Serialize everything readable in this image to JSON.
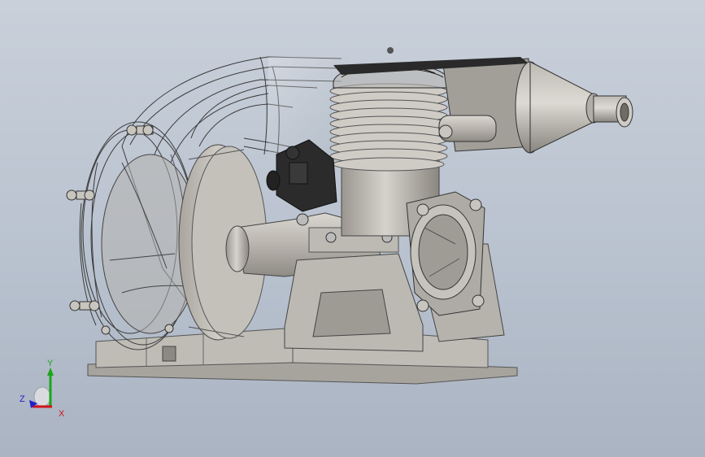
{
  "viewport": {
    "background_top": "#c9d0da",
    "background_bottom": "#aab4c2"
  },
  "triad": {
    "x_label": "X",
    "y_label": "Y",
    "z_label": "Z",
    "x_color": "#d0121b",
    "y_color": "#1aa51a",
    "z_color": "#2222c8"
  },
  "model": {
    "icons": [
      "engine-3d-model",
      "muffler-cone",
      "cylinder-fins",
      "flywheel-disc",
      "transparent-fan-housing",
      "mount-base",
      "carburetor-block"
    ]
  }
}
